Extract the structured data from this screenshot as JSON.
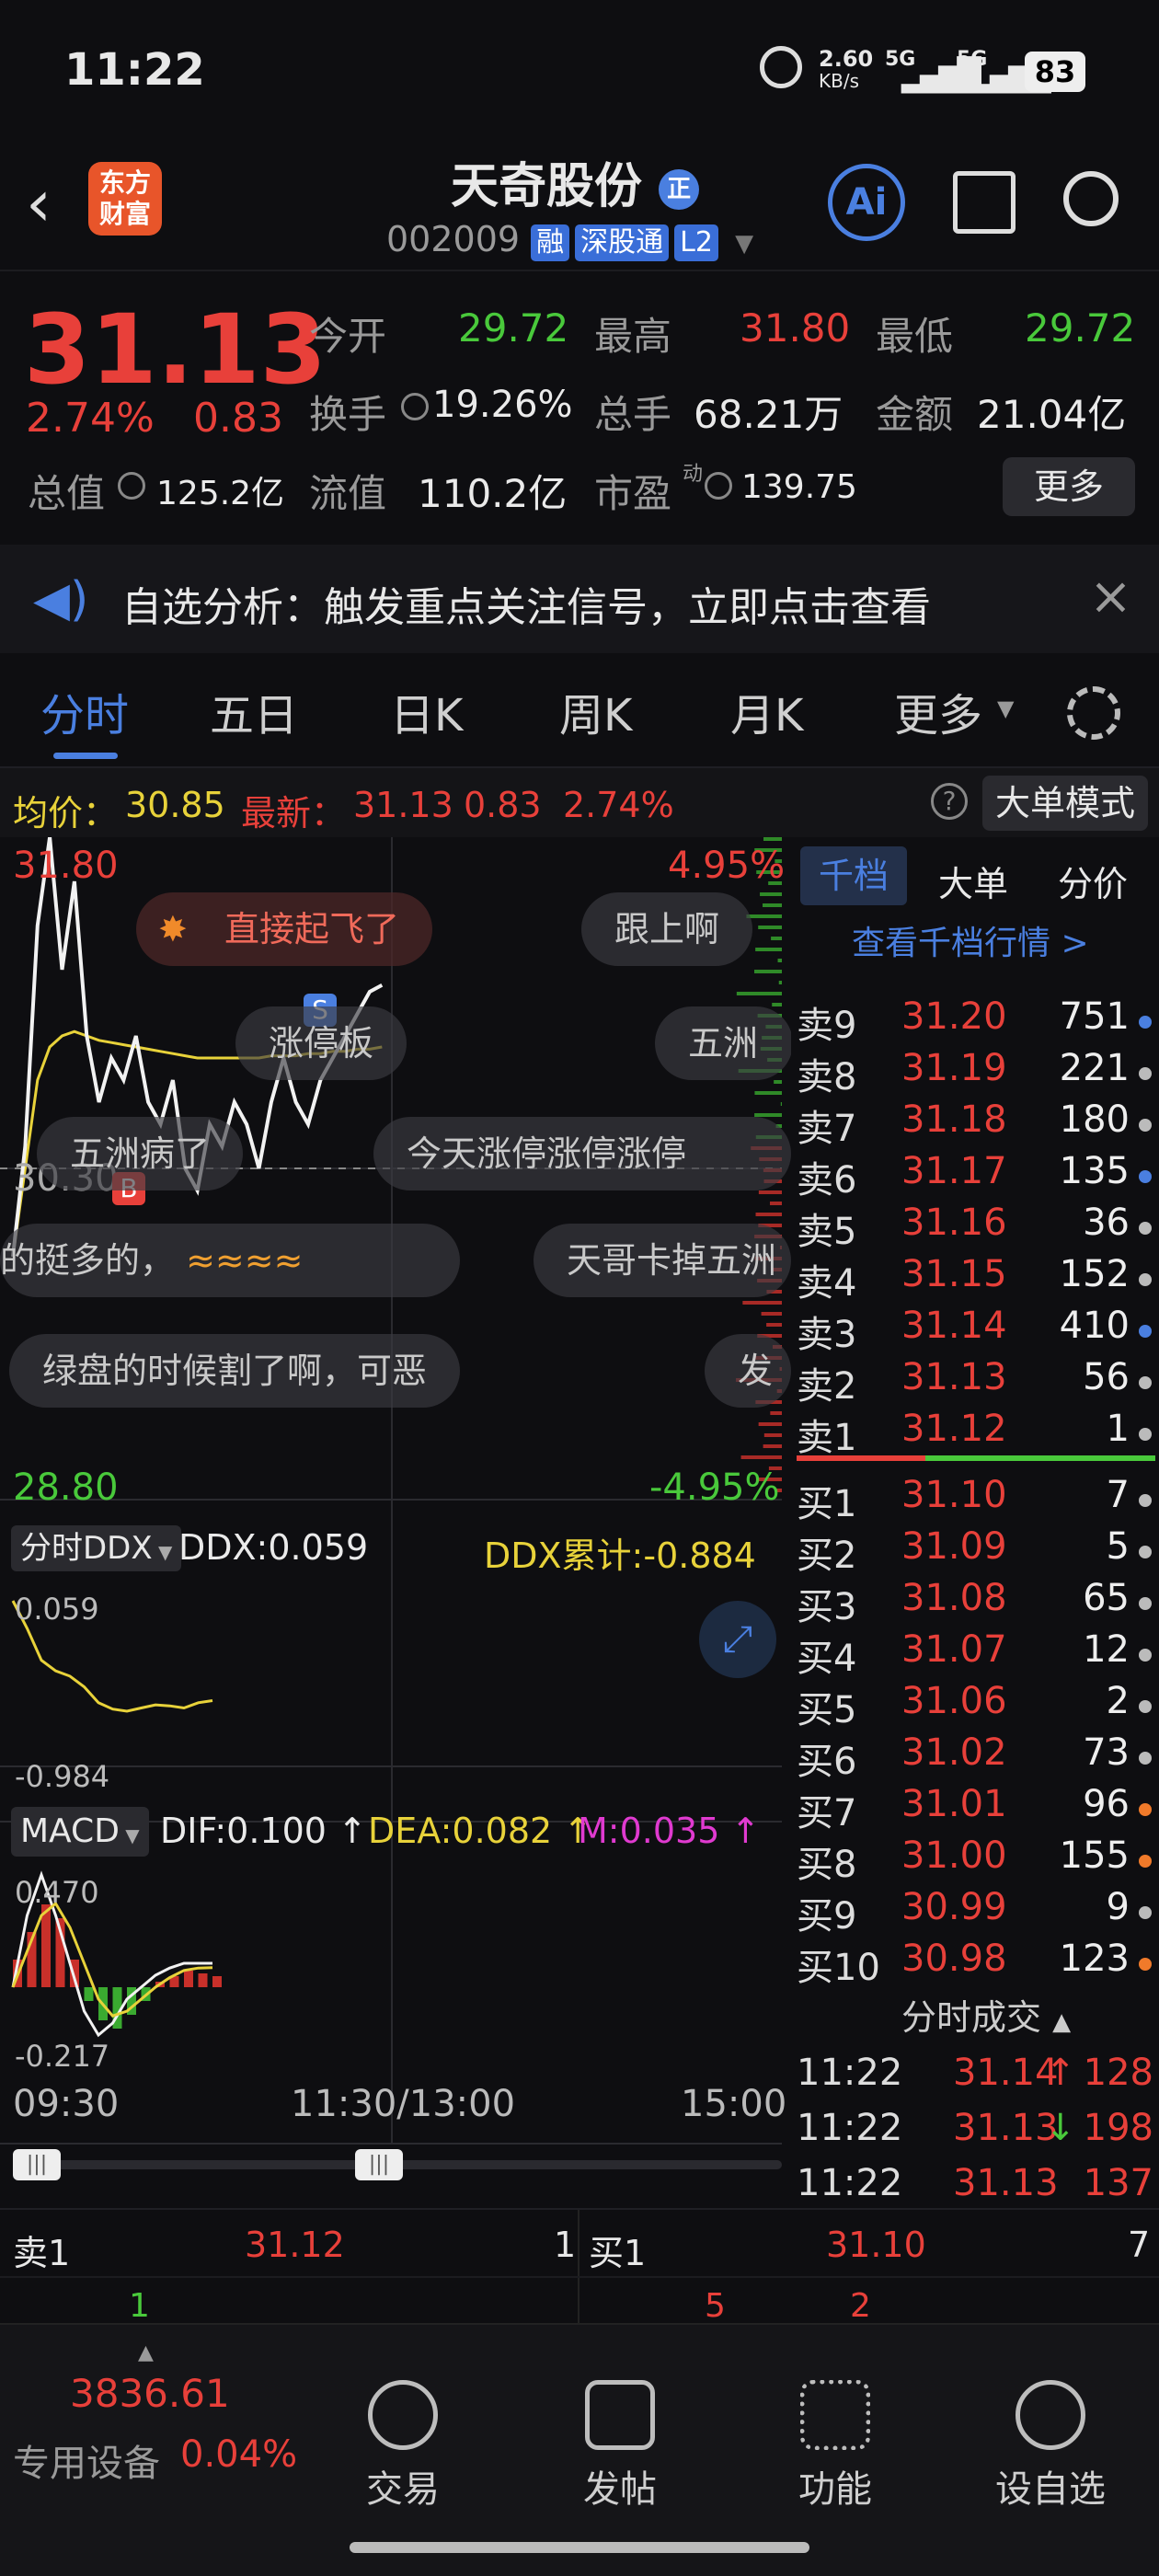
{
  "status": {
    "time": "11:22",
    "net_speed": "2.60",
    "net_unit": "KB/s",
    "sig1": "5G",
    "sig2": "5G",
    "battery": "83"
  },
  "header": {
    "logo_line1": "东方",
    "logo_line2": "财富",
    "title": "天奇股份",
    "title_badge": "正",
    "code": "002009",
    "tags": [
      "融",
      "深股通",
      "L2"
    ],
    "ai_label": "Ai"
  },
  "quote": {
    "price": "31.13",
    "pct": "2.74%",
    "chg": "0.83",
    "open_label": "今开",
    "open": "29.72",
    "high_label": "最高",
    "high": "31.80",
    "low_label": "最低",
    "low": "29.72",
    "turnover_label": "换手",
    "turnover": "19.26%",
    "volume_label": "总手",
    "volume": "68.21万",
    "amount_label": "金额",
    "amount": "21.04亿",
    "mktcap_label": "总值",
    "mktcap": "125.2亿",
    "float_label": "流值",
    "float": "110.2亿",
    "pe_label": "市盈",
    "pe_sup": "动",
    "pe": "139.75",
    "more": "更多"
  },
  "banner": {
    "text": "自选分析：触发重点关注信号，立即点击查看"
  },
  "tabs": [
    "分时",
    "五日",
    "日K",
    "周K",
    "月K",
    "更多"
  ],
  "infobar": {
    "avg_label": "均价：",
    "avg": "30.85",
    "latest_label": "最新：",
    "latest": "31.13",
    "chg": "0.83",
    "pct": "2.74%",
    "mode": "大单模式"
  },
  "chart": {
    "top_price": "31.80",
    "mid_price": "30.30",
    "bottom_price": "28.80",
    "top_pct": "4.95%",
    "bottom_pct": "-4.95%",
    "marker_b": "B",
    "marker_s": "S",
    "ddx_label": "分时DDX",
    "ddx": "DDX:0.059",
    "ddx_cum": "DDX累计:-0.884",
    "ddx_top": "0.059",
    "ddx_bottom": "-0.984",
    "macd_label": "MACD",
    "dif": "DIF:0.100",
    "dea": "DEA:0.082",
    "m": "M:0.035",
    "macd_top": "0.470",
    "macd_bottom": "-0.217",
    "time_start": "09:30",
    "time_mid": "11:30/13:00",
    "time_end": "15:00"
  },
  "chart_data": {
    "type": "line",
    "series": [
      {
        "name": "价格",
        "values": [
          29.9,
          30.4,
          31.4,
          31.8,
          31.2,
          31.6,
          30.9,
          30.6,
          30.8,
          30.7,
          30.9,
          30.6,
          30.5,
          30.7,
          30.3,
          30.2,
          30.5,
          30.4,
          30.6,
          30.5,
          30.3,
          30.6,
          30.8,
          30.6,
          30.5,
          30.7,
          30.8,
          30.9,
          31.0,
          31.1,
          31.13
        ]
      },
      {
        "name": "均价",
        "values": [
          29.9,
          30.3,
          30.7,
          30.85,
          30.9,
          30.92,
          30.9,
          30.88,
          30.87,
          30.86,
          30.85,
          30.84,
          30.83,
          30.82,
          30.81,
          30.8,
          30.8,
          30.8,
          30.8,
          30.8,
          30.8,
          30.81,
          30.81,
          30.81,
          30.82,
          30.82,
          30.83,
          30.83,
          30.84,
          30.84,
          30.85
        ]
      }
    ],
    "ylim": [
      28.8,
      31.8
    ]
  },
  "danmaku": [
    "直接起飞了",
    "跟上啊",
    "涨停板",
    "五洲",
    "五洲病了",
    "今天涨停涨停涨停",
    "的挺多的，",
    "天哥卡掉五洲",
    "绿盘的时候割了啊，可恶",
    "发"
  ],
  "orderbook": {
    "tabs": [
      "千档",
      "大单",
      "分价"
    ],
    "link": "查看千档行情 >",
    "asks": [
      {
        "label": "卖9",
        "price": "31.20",
        "vol": "751",
        "dot": "#4a7fe0"
      },
      {
        "label": "卖8",
        "price": "31.19",
        "vol": "221",
        "dot": "#bbbbbb"
      },
      {
        "label": "卖7",
        "price": "31.18",
        "vol": "180",
        "dot": "#bbbbbb"
      },
      {
        "label": "卖6",
        "price": "31.17",
        "vol": "135",
        "dot": "#4a7fe0"
      },
      {
        "label": "卖5",
        "price": "31.16",
        "vol": "36",
        "dot": "#bbbbbb"
      },
      {
        "label": "卖4",
        "price": "31.15",
        "vol": "152",
        "dot": "#bbbbbb"
      },
      {
        "label": "卖3",
        "price": "31.14",
        "vol": "410",
        "dot": "#4a7fe0"
      },
      {
        "label": "卖2",
        "price": "31.13",
        "vol": "56",
        "dot": "#bbbbbb"
      },
      {
        "label": "卖1",
        "price": "31.12",
        "vol": "1",
        "dot": "#bbbbbb"
      }
    ],
    "bids": [
      {
        "label": "买1",
        "price": "31.10",
        "vol": "7",
        "dot": "#bbbbbb"
      },
      {
        "label": "买2",
        "price": "31.09",
        "vol": "5",
        "dot": "#bbbbbb"
      },
      {
        "label": "买3",
        "price": "31.08",
        "vol": "65",
        "dot": "#bbbbbb"
      },
      {
        "label": "买4",
        "price": "31.07",
        "vol": "12",
        "dot": "#bbbbbb"
      },
      {
        "label": "买5",
        "price": "31.06",
        "vol": "2",
        "dot": "#bbbbbb"
      },
      {
        "label": "买6",
        "price": "31.02",
        "vol": "73",
        "dot": "#bbbbbb"
      },
      {
        "label": "买7",
        "price": "31.01",
        "vol": "96",
        "dot": "#f07a2a"
      },
      {
        "label": "买8",
        "price": "31.00",
        "vol": "155",
        "dot": "#f07a2a"
      },
      {
        "label": "买9",
        "price": "30.99",
        "vol": "9",
        "dot": "#bbbbbb"
      },
      {
        "label": "买10",
        "price": "30.98",
        "vol": "123",
        "dot": "#f07a2a"
      }
    ],
    "trades_label": "分时成交",
    "trades": [
      {
        "time": "11:22",
        "price": "31.14",
        "arrow": "↑",
        "vol": "128",
        "color": "#e8403a"
      },
      {
        "time": "11:22",
        "price": "31.13",
        "arrow": "↓",
        "vol": "198",
        "color": "#e8403a"
      },
      {
        "time": "11:22",
        "price": "31.13",
        "arrow": "",
        "vol": "137",
        "color": "#e8403a"
      }
    ]
  },
  "bottomq": {
    "ask_label": "卖1",
    "ask_price": "31.12",
    "ask_vol": "1",
    "bid_label": "买1",
    "bid_price": "31.10",
    "bid_vol": "7",
    "ask_detail": "1",
    "bid_detail1": "5",
    "bid_detail2": "2"
  },
  "nav": {
    "index": "3836.61",
    "index_label": "专用设备",
    "index_pct": "0.04%",
    "items": [
      "交易",
      "发帖",
      "功能",
      "设自选"
    ]
  }
}
